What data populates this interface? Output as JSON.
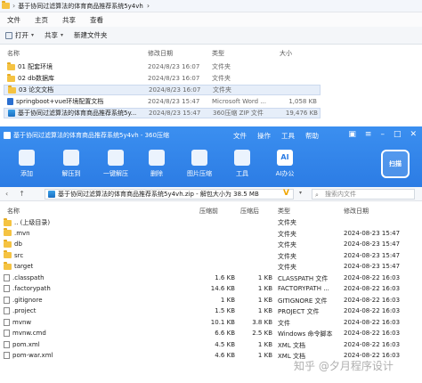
{
  "explorer": {
    "breadcrumb": "基于协同过滤算法的体育商品推荐系统5y4vh",
    "menu": [
      "文件",
      "主页",
      "共享",
      "查看"
    ],
    "toolbar": [
      {
        "label": "打开"
      },
      {
        "label": "共享"
      },
      {
        "label": "新建文件夹"
      }
    ],
    "columns": {
      "name": "名称",
      "date": "修改日期",
      "type": "类型",
      "size": "大小"
    },
    "files": [
      {
        "name": "01 配套环境",
        "date": "2024/8/23 16:07",
        "type": "文件夹",
        "size": "",
        "icon": "folder-icon"
      },
      {
        "name": "02 db数据库",
        "date": "2024/8/23 16:07",
        "type": "文件夹",
        "size": "",
        "icon": "folder-icon"
      },
      {
        "name": "03 论文文档",
        "date": "2024/8/23 16:07",
        "type": "文件夹",
        "size": "",
        "icon": "folder-icon"
      },
      {
        "name": "springboot+vue环境配置文档",
        "date": "2024/8/23 15:47",
        "type": "Microsoft Word ...",
        "size": "1,058 KB",
        "icon": "word-doc-icon"
      },
      {
        "name": "基于协同过滤算法的体育商品推荐系统5y...",
        "date": "2024/8/23 15:47",
        "type": "360压缩 ZIP 文件",
        "size": "19,476 KB",
        "icon": "zip-icon"
      }
    ]
  },
  "zip": {
    "title": "基于协同过滤算法的体育商品推荐系统5y4vh - 360压缩",
    "menu": [
      "文件",
      "操作",
      "工具",
      "帮助"
    ],
    "tools": [
      {
        "label": "添加",
        "icon": "add-icon"
      },
      {
        "label": "解压到",
        "icon": "extract-icon"
      },
      {
        "label": "一键解压",
        "icon": "one-click-extract-icon"
      },
      {
        "label": "删除",
        "icon": "delete-icon"
      },
      {
        "label": "图片压缩",
        "icon": "image-compress-icon"
      },
      {
        "label": "工具",
        "icon": "tools-icon"
      },
      {
        "label": "AI办公",
        "icon": "ai-icon"
      }
    ],
    "scan_label": "扫描",
    "address": "基于协同过滤算法的体育商品推荐系统5y4vh.zip - 解包大小为 38.5 MB",
    "search_placeholder": "搜索内文件",
    "columns": {
      "name": "名称",
      "size": "压缩前",
      "csize": "压缩后",
      "type": "类型",
      "date": "修改日期"
    },
    "files": [
      {
        "name": ".. (上级目录)",
        "size": "",
        "csize": "",
        "type": "文件夹",
        "date": "",
        "icon": "folder-icon"
      },
      {
        "name": ".mvn",
        "size": "",
        "csize": "",
        "type": "文件夹",
        "date": "2024-08-23 15:47",
        "icon": "folder-icon"
      },
      {
        "name": "db",
        "size": "",
        "csize": "",
        "type": "文件夹",
        "date": "2024-08-23 15:47",
        "icon": "folder-icon"
      },
      {
        "name": "src",
        "size": "",
        "csize": "",
        "type": "文件夹",
        "date": "2024-08-23 15:47",
        "icon": "folder-icon"
      },
      {
        "name": "target",
        "size": "",
        "csize": "",
        "type": "文件夹",
        "date": "2024-08-23 15:47",
        "icon": "folder-icon"
      },
      {
        "name": ".classpath",
        "size": "1.6 KB",
        "csize": "1 KB",
        "type": "CLASSPATH 文件",
        "date": "2024-08-22 16:03",
        "icon": "file-icon"
      },
      {
        "name": ".factorypath",
        "size": "14.6 KB",
        "csize": "1 KB",
        "type": "FACTORYPATH ...",
        "date": "2024-08-22 16:03",
        "icon": "file-icon"
      },
      {
        "name": ".gitignore",
        "size": "1 KB",
        "csize": "1 KB",
        "type": "GITIGNORE 文件",
        "date": "2024-08-22 16:03",
        "icon": "file-icon"
      },
      {
        "name": ".project",
        "size": "1.5 KB",
        "csize": "1 KB",
        "type": "PROJECT 文件",
        "date": "2024-08-22 16:03",
        "icon": "file-icon"
      },
      {
        "name": "mvnw",
        "size": "10.1 KB",
        "csize": "3.8 KB",
        "type": "文件",
        "date": "2024-08-22 16:03",
        "icon": "file-icon"
      },
      {
        "name": "mvnw.cmd",
        "size": "6.6 KB",
        "csize": "2.5 KB",
        "type": "Windows 命令脚本",
        "date": "2024-08-22 16:03",
        "icon": "file-icon"
      },
      {
        "name": "pom.xml",
        "size": "4.5 KB",
        "csize": "1 KB",
        "type": "XML 文档",
        "date": "2024-08-22 16:03",
        "icon": "file-icon"
      },
      {
        "name": "pom-war.xml",
        "size": "4.6 KB",
        "csize": "1 KB",
        "type": "XML 文档",
        "date": "2024-08-22 16:03",
        "icon": "file-icon"
      }
    ]
  },
  "watermark": "知乎 @夕月程序设计"
}
